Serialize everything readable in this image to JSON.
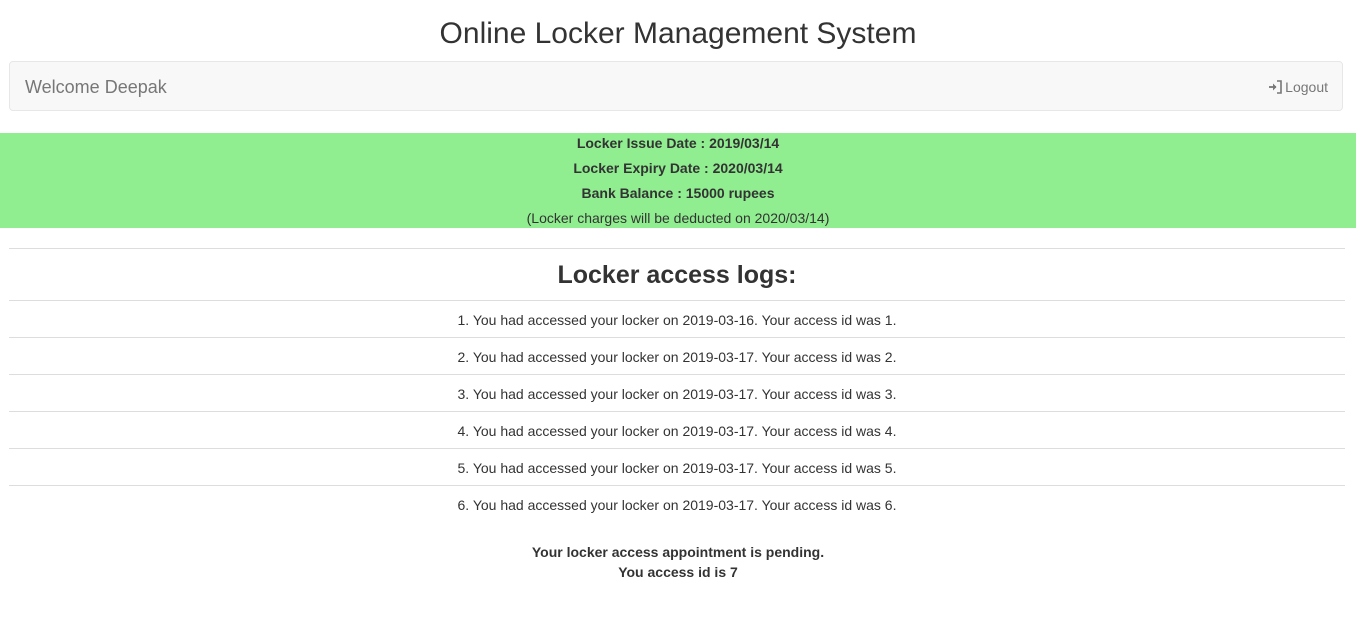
{
  "app": {
    "title": "Online Locker Management System"
  },
  "navbar": {
    "welcome": "Welcome Deepak",
    "logout_label": "Logout",
    "logout_icon": "sign-in-icon"
  },
  "locker_info": {
    "issue_date": "Locker Issue Date : 2019/03/14",
    "expiry_date": "Locker Expiry Date : 2020/03/14",
    "bank_balance": "Bank Balance : 15000 rupees",
    "charges_note": "(Locker charges will be deducted on 2020/03/14)",
    "banner_color": "#90ee90"
  },
  "logs": {
    "heading": "Locker access logs:",
    "entries": [
      "1. You had accessed your locker on 2019-03-16. Your access id was 1.",
      "2. You had accessed your locker on 2019-03-17. Your access id was 2.",
      "3. You had accessed your locker on 2019-03-17. Your access id was 3.",
      "4. You had accessed your locker on 2019-03-17. Your access id was 4.",
      "5. You had accessed your locker on 2019-03-17. Your access id was 5.",
      "6. You had accessed your locker on 2019-03-17. Your access id was 6."
    ]
  },
  "appointment": {
    "status": "Your locker access appointment is pending.",
    "access_id": "You access id is 7"
  }
}
